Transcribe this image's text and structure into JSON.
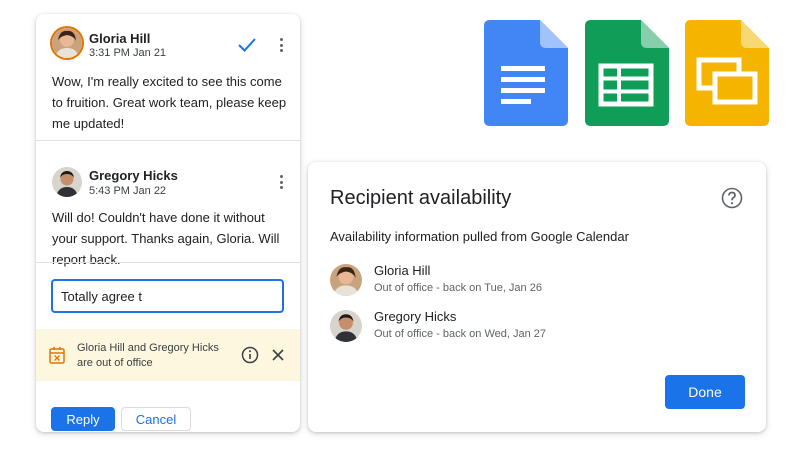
{
  "comments": [
    {
      "author": "Gloria Hill",
      "time": "3:31 PM Jan 21",
      "body": "Wow, I'm really excited to see this come to fruition. Great work team, please keep me updated!",
      "resolved_icon": "checkmark-icon"
    },
    {
      "author": "Gregory Hicks",
      "time": "5:43 PM Jan 22",
      "body": "Will do! Couldn't have done it without your support. Thanks again, Gloria. Will report back."
    }
  ],
  "reply": {
    "input_value": "Totally agree t",
    "ooo_message": "Gloria Hill and Gregory Hicks are out of office",
    "reply_label": "Reply",
    "cancel_label": "Cancel"
  },
  "apps": [
    "docs-icon",
    "sheets-icon",
    "slides-icon"
  ],
  "availability": {
    "title": "Recipient availability",
    "subtitle": "Availability information pulled from Google Calendar",
    "people": [
      {
        "name": "Gloria Hill",
        "status": "Out of office - back on Tue, Jan 26"
      },
      {
        "name": "Gregory Hicks",
        "status": "Out of office - back on Wed, Jan 27"
      }
    ],
    "done_label": "Done"
  },
  "colors": {
    "accent": "#1a73e8",
    "banner": "#fef7e0",
    "docs": "#4285f4",
    "sheets": "#0f9d58",
    "slides": "#f4b400"
  }
}
